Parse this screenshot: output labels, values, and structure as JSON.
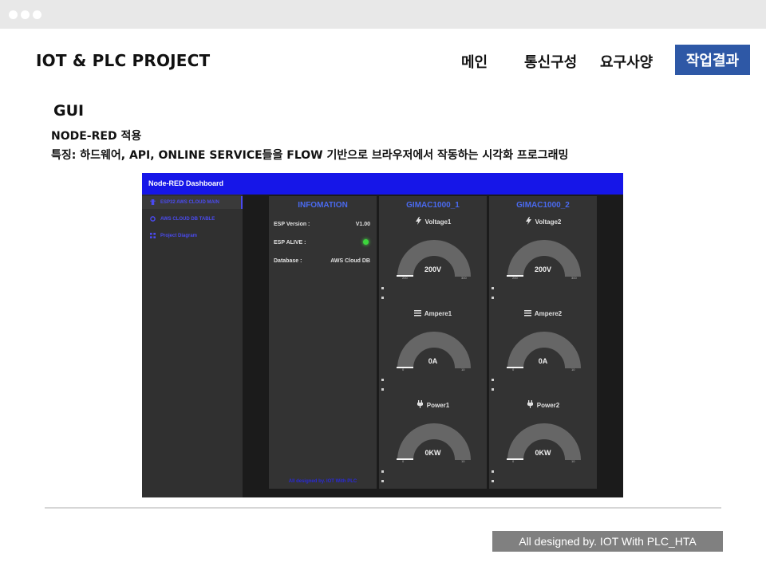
{
  "brand": "IOT & PLC PROJECT",
  "nav": {
    "items": [
      {
        "label": "메인"
      },
      {
        "label": "통신구성"
      },
      {
        "label": "요구사양"
      },
      {
        "label": "작업결과"
      }
    ],
    "active_color": "#2e58a6"
  },
  "section": {
    "title": "GUI",
    "line1": "NODE-RED 적용",
    "line2": "특징: 하드웨어, API, ONLINE SERVICE들을 FLOW 기반으로 브라우저에서 작동하는 시각화 프로그래밍"
  },
  "dashboard": {
    "header": "Node-RED Dashboard",
    "header_color": "#1616e8",
    "sidebar": [
      {
        "label": "ESP32 AWS CLOUD MAIN",
        "icon": "device-icon"
      },
      {
        "label": "AWS CLOUD DB TABLE",
        "icon": "circle-icon"
      },
      {
        "label": "Project Diagram",
        "icon": "grid-icon"
      }
    ],
    "info": {
      "title": "INFOMATION",
      "rows": [
        {
          "label": "ESP Version :",
          "value": "V1.00"
        },
        {
          "label": "ESP ALIVE :",
          "value": ""
        },
        {
          "label": "Database :",
          "value": "AWS Cloud DB"
        }
      ],
      "footer": "All designed by. IOT With PLC",
      "alive_led_color": "#3cd63c"
    },
    "devices": [
      {
        "title": "GIMAC1000_1",
        "gauges": [
          {
            "label": "Voltage1",
            "icon": "lightning-icon",
            "value_text": "200V",
            "value": 200,
            "min": "200",
            "max": "300",
            "level": 0.0
          },
          {
            "label": "Ampere1",
            "icon": "bars-icon",
            "value_text": "0A",
            "value": 0,
            "min": "0",
            "max": "10",
            "level": 0.0
          },
          {
            "label": "Power1",
            "icon": "plug-icon",
            "value_text": "0KW",
            "value": 0,
            "min": "0",
            "max": "10",
            "level": 0.0
          }
        ]
      },
      {
        "title": "GIMAC1000_2",
        "gauges": [
          {
            "label": "Voltage2",
            "icon": "lightning-icon",
            "value_text": "200V",
            "value": 200,
            "min": "200",
            "max": "300",
            "level": 0.0
          },
          {
            "label": "Ampere2",
            "icon": "bars-icon",
            "value_text": "0A",
            "value": 0,
            "min": "0",
            "max": "10",
            "level": 0.0
          },
          {
            "label": "Power2",
            "icon": "plug-icon",
            "value_text": "0KW",
            "value": 0,
            "min": "0",
            "max": "10",
            "level": 0.0
          }
        ]
      }
    ]
  },
  "credit": "All designed by. IOT With PLC_HTA"
}
